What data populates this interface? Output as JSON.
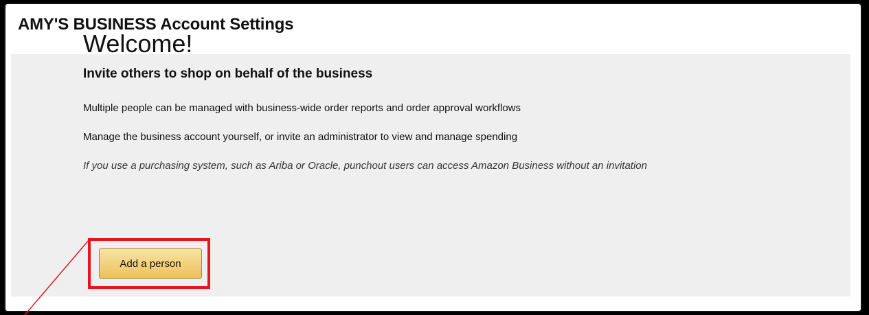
{
  "header": {
    "title": "AMY'S BUSINESS Account Settings"
  },
  "welcome_panel": {
    "heading": "Welcome!",
    "subheading": "Invite others to shop on behalf of the business",
    "lines": [
      "Multiple people can be managed with business-wide order reports and order approval workflows",
      "Manage the business account yourself, or invite an administrator to view and manage spending",
      "If you use a purchasing system, such as Ariba or Oracle, punchout users can access Amazon Business without an invitation"
    ],
    "add_person_label": "Add a person"
  },
  "colors": {
    "highlight": "#e8141b",
    "button_top": "#f8e3a2",
    "button_bottom": "#ecc15a",
    "panel_bg": "#efefef"
  }
}
